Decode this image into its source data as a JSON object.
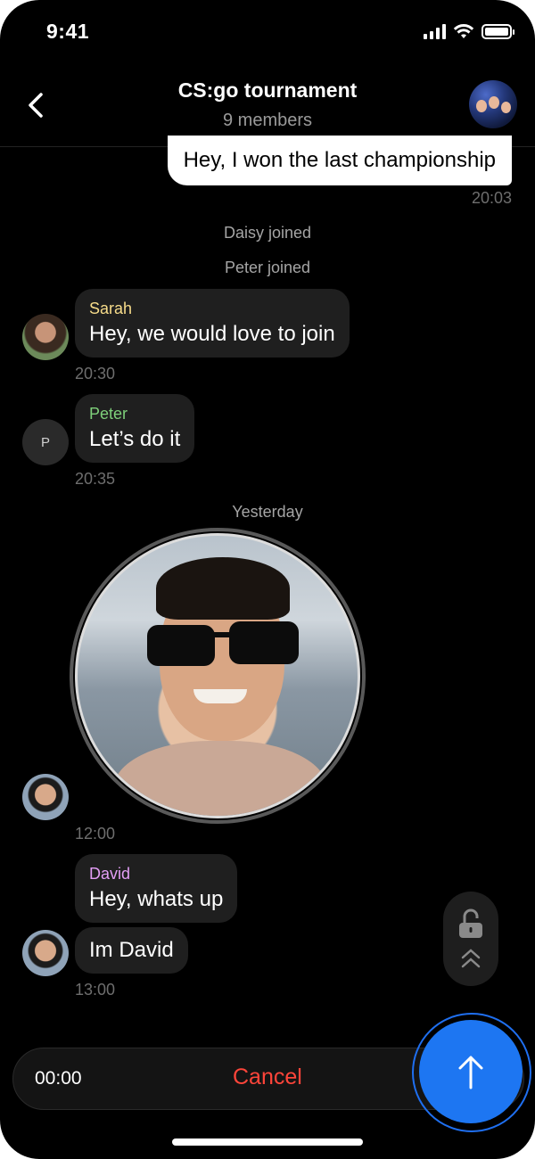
{
  "status_bar": {
    "time": "9:41"
  },
  "header": {
    "title": "CS:go tournament",
    "subtitle": "9 members"
  },
  "messages": {
    "outgoing": {
      "text": "Hey, I won the last championship",
      "time": "20:03"
    },
    "system": [
      "Daisy joined",
      "Peter joined"
    ],
    "sarah": {
      "name": "Sarah",
      "text": "Hey, we would love to join",
      "time": "20:30",
      "name_color": "#f7dc8a"
    },
    "peter": {
      "initial": "P",
      "name": "Peter",
      "text": "Let’s do it",
      "time": "20:35",
      "name_color": "#7ed07a"
    },
    "day_divider": "Yesterday",
    "video": {
      "time": "12:00"
    },
    "david": {
      "name": "David",
      "text1": "Hey, whats up",
      "text2": "Im David",
      "time": "13:00",
      "name_color": "#e39ef5"
    }
  },
  "recording": {
    "timer": "00:00",
    "cancel_label": "Cancel"
  },
  "icons": {
    "back": "chevron-left-icon",
    "lock": "lock-open-icon",
    "swipe_up": "double-chevron-up-icon",
    "send": "arrow-up-icon"
  },
  "colors": {
    "accent": "#1d76f2",
    "cancel": "#ff453a",
    "bubble": "#1f1f1f"
  }
}
